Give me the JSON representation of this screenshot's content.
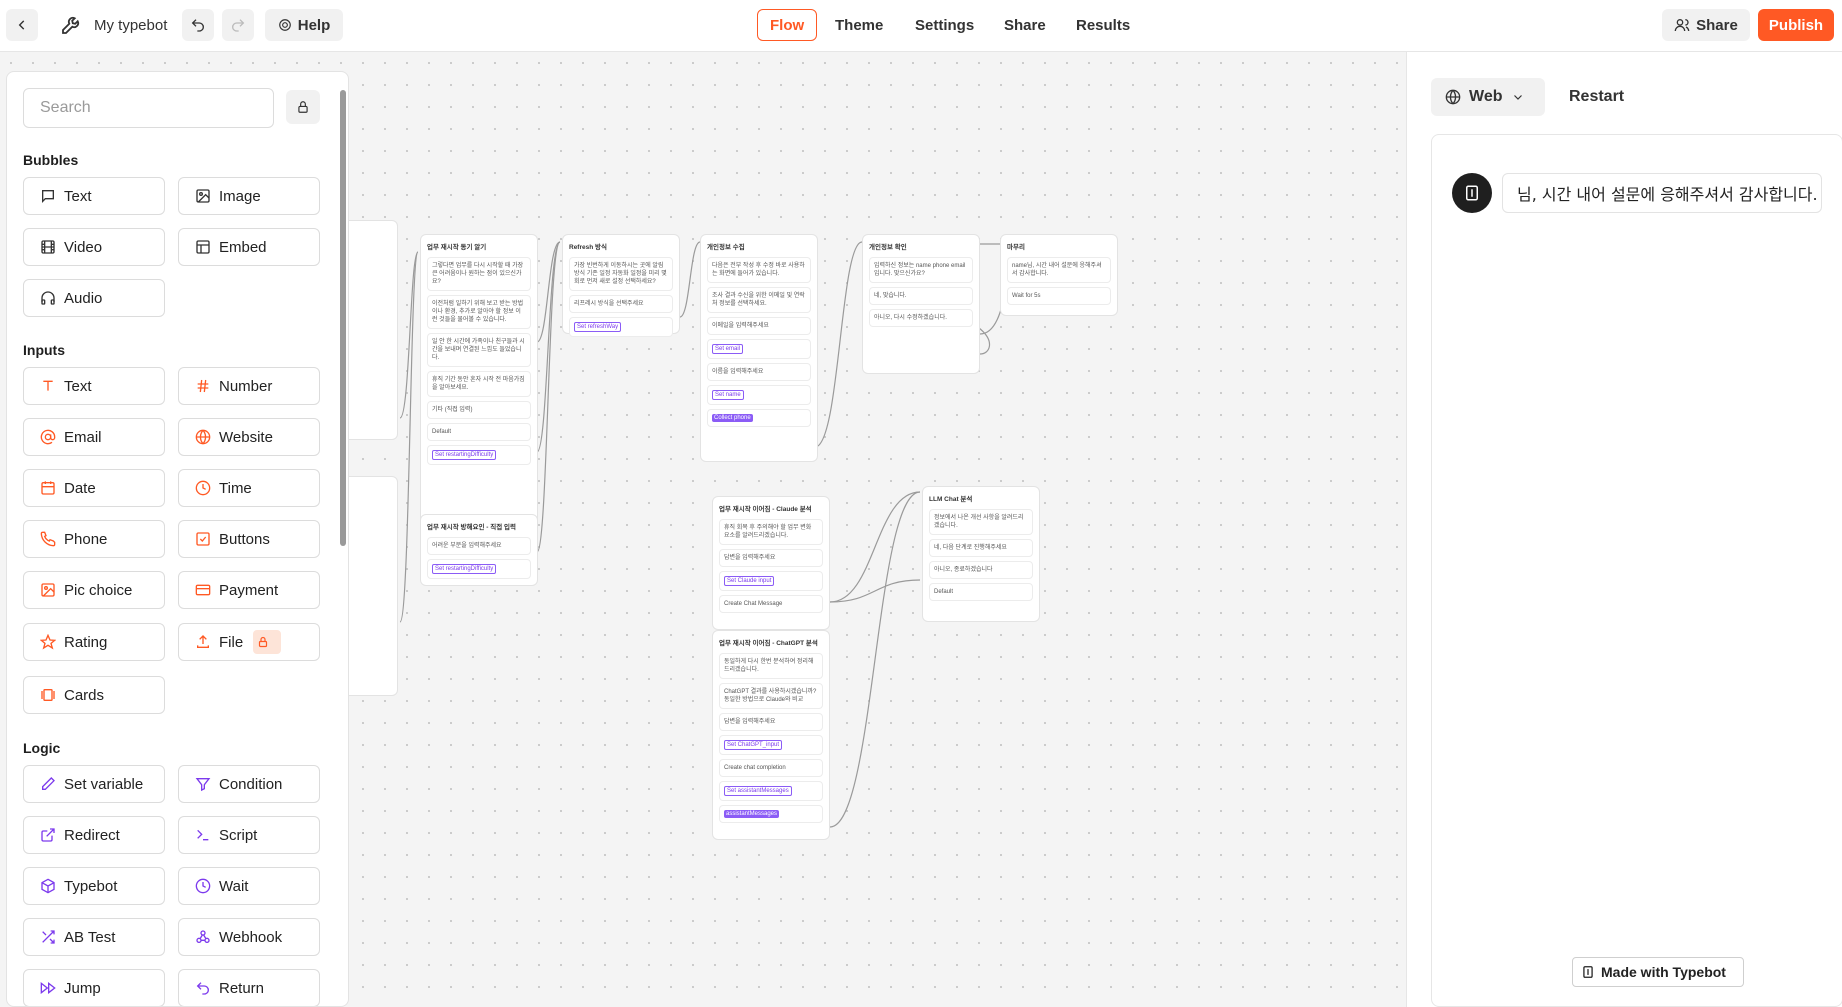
{
  "header": {
    "typebot_name": "My typebot",
    "help_label": "Help",
    "tabs": [
      {
        "label": "Flow",
        "active": true
      },
      {
        "label": "Theme"
      },
      {
        "label": "Settings"
      },
      {
        "label": "Share"
      },
      {
        "label": "Results"
      }
    ],
    "share_label": "Share",
    "publish_label": "Publish",
    "accent_color": "#ff5924"
  },
  "sidebar": {
    "search_placeholder": "Search",
    "sections": [
      {
        "title": "Bubbles",
        "items": [
          {
            "label": "Text",
            "icon": "chat-bubble-icon"
          },
          {
            "label": "Image",
            "icon": "image-icon"
          },
          {
            "label": "Video",
            "icon": "film-icon"
          },
          {
            "label": "Embed",
            "icon": "layout-icon"
          },
          {
            "label": "Audio",
            "icon": "headphones-icon"
          }
        ]
      },
      {
        "title": "Inputs",
        "items": [
          {
            "label": "Text",
            "icon": "text-input-icon"
          },
          {
            "label": "Number",
            "icon": "hash-icon"
          },
          {
            "label": "Email",
            "icon": "at-sign-icon"
          },
          {
            "label": "Website",
            "icon": "globe-icon"
          },
          {
            "label": "Date",
            "icon": "calendar-icon"
          },
          {
            "label": "Time",
            "icon": "clock-icon"
          },
          {
            "label": "Phone",
            "icon": "phone-icon"
          },
          {
            "label": "Buttons",
            "icon": "checkbox-icon"
          },
          {
            "label": "Pic choice",
            "icon": "picture-choice-icon"
          },
          {
            "label": "Payment",
            "icon": "credit-card-icon"
          },
          {
            "label": "Rating",
            "icon": "star-icon"
          },
          {
            "label": "File",
            "icon": "upload-icon",
            "locked": true
          },
          {
            "label": "Cards",
            "icon": "cards-icon"
          }
        ]
      },
      {
        "title": "Logic",
        "items": [
          {
            "label": "Set variable",
            "icon": "pencil-icon"
          },
          {
            "label": "Condition",
            "icon": "filter-icon"
          },
          {
            "label": "Redirect",
            "icon": "external-link-icon"
          },
          {
            "label": "Script",
            "icon": "terminal-icon"
          },
          {
            "label": "Typebot",
            "icon": "cube-icon"
          },
          {
            "label": "Wait",
            "icon": "clock-icon"
          },
          {
            "label": "AB Test",
            "icon": "shuffle-icon"
          },
          {
            "label": "Webhook",
            "icon": "webhook-icon"
          },
          {
            "label": "Jump",
            "icon": "fast-forward-icon"
          },
          {
            "label": "Return",
            "icon": "undo-icon"
          }
        ]
      }
    ]
  },
  "preview": {
    "runtime_label": "Web",
    "restart_label": "Restart",
    "message": "님, 시간 내어 설문에 응해주셔서 감사합니다.",
    "badge_label": "Made with Typebot"
  },
  "canvas": {
    "groups": [
      {
        "title": "업무 재시작 동기 알기",
        "lines": [
          "그렇다면 업무를 다시 시작할 때 가장 큰 어려움이나 원하는 점이 있으신가요?",
          "이전처럼 일하기 위해 보고 받는 방법이나 환경, 추가로 알아야 할 정보 이런 것들을 물어볼 수 있습니다.",
          "일 안 한 시간에 가족이나 친구들과 시간을 보내며 연결된 느낌도 들었습니다.",
          "휴직 기간 동안 혼자 시작 전 마음가짐을 알아보세요.",
          "기타 (직접 입력)",
          "Default",
          "Set restartingDifficulty"
        ]
      },
      {
        "title": "Refresh 방식",
        "lines": [
          "가장 빈번하게 이동하시는 곳에 알림 방식 기존 일정 자동화 일정을 미리 몇 회로 먼저 새로 설정 선택하세요?",
          "리프레시 방식을 선택주세요",
          "Set refreshWay"
        ]
      },
      {
        "title": "개인정보 수집",
        "lines": [
          "다음은 전부 작성 후 수정 바로 사용하는 화면에 들어가 있습니다.",
          "조사 결과 수신을 위한 이메일 및 연락처 정보를 선택하세요.",
          "이메일을 입력해주세요",
          "Set email",
          "이름을 입력해주세요",
          "Set name",
          "Collect phone"
        ]
      },
      {
        "title": "개인정보 확인",
        "lines": [
          "입력하신 정보는 name phone email 입니다. 맞으신가요?",
          "네, 맞습니다.",
          "아니오, 다시 수정하겠습니다."
        ]
      },
      {
        "title": "마무리",
        "lines": [
          "name님, 시간 내어 설문에 응해주셔서 감사합니다.",
          "Wait for 5s"
        ]
      },
      {
        "title": "업무 재시작 방해요인 - 직접 입력",
        "lines": [
          "어려운 부분을 입력해주세요",
          "Set restartingDifficulty"
        ]
      },
      {
        "title": "업무 재시작 이어짐 - Claude 분석",
        "lines": [
          "휴직 회복 후 주의해야 할 업무 변화 요소를 알려드리겠습니다.",
          "답변을 입력해주세요",
          "Set Claude input",
          "Create Chat Message"
        ]
      },
      {
        "title": "업무 재시작 이어짐 - ChatGPT 분석",
        "lines": [
          "동일하게 다시 한번 분석하여 정리해 드리겠습니다.",
          "ChatGPT 결과를 사용하시겠습니까? 동일한 방법으로 Claude와 비교",
          "답변을 입력해주세요",
          "Set ChatGPT_input",
          "Create chat completion",
          "Set assistantMessages",
          "assistantMessages"
        ]
      },
      {
        "title": "LLM Chat 분석",
        "lines": [
          "정보에서 나온 개선 사항을 알려드리겠습니다.",
          "네, 다음 단계로 진행해주세요",
          "아니오, 종료하겠습니다",
          "Default"
        ]
      }
    ]
  }
}
